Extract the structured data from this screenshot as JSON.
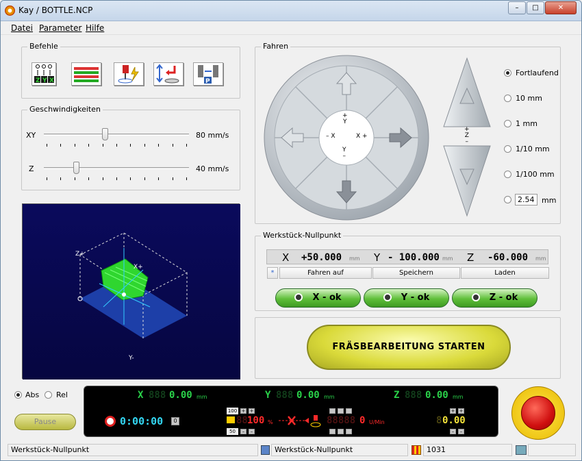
{
  "window": {
    "title": "Kay / BOTTLE.NCP",
    "minimize": "–",
    "maximize": "□",
    "close": "✕"
  },
  "menu": {
    "items": [
      "Datei",
      "Parameter",
      "Hilfe"
    ]
  },
  "befehle": {
    "label": "Befehle",
    "buttons": [
      "zyx-order-icon",
      "table-grid-icon",
      "spindle-lightning-icon",
      "tool-change-icon",
      "probe-p-icon"
    ]
  },
  "geschwindigkeiten": {
    "label": "Geschwindigkeiten",
    "xy": {
      "label": "XY",
      "value": "80 mm/s",
      "fraction": 0.42
    },
    "z": {
      "label": "Z",
      "value": "40 mm/s",
      "fraction": 0.22
    }
  },
  "preview": {
    "zplus": "Z+",
    "xplus": "X+",
    "yminus": "Y-"
  },
  "fahren": {
    "label": "Fahren",
    "center": {
      "yplus": "+\nY",
      "xminus": "– X",
      "xplus": "X +",
      "yminus": "Y\n–"
    },
    "zlabel": "+\nZ\n–",
    "steps": [
      {
        "label": "Fortlaufend",
        "checked": true
      },
      {
        "label": "10 mm",
        "checked": false
      },
      {
        "label": "1 mm",
        "checked": false
      },
      {
        "label": "1/10 mm",
        "checked": false
      },
      {
        "label": "1/100 mm",
        "checked": false
      }
    ],
    "custom": {
      "value": "2.54",
      "unit": "mm"
    }
  },
  "nullpunkt": {
    "label": "Werkstück-Nullpunkt",
    "x": {
      "axis": "X",
      "value": "+50.000",
      "unit": "mm"
    },
    "y": {
      "axis": "Y",
      "value": "- 100.000",
      "unit": "mm"
    },
    "z": {
      "axis": "Z",
      "value": "-60.000",
      "unit": "mm"
    },
    "star": "*",
    "buttons": {
      "fahren": "Fahren auf",
      "speichern": "Speichern",
      "laden": "Laden"
    },
    "ok": {
      "x": "X - ok",
      "y": "Y - ok",
      "z": "Z - ok"
    }
  },
  "start": {
    "label": "FRÄSBEARBEITUNG  STARTEN"
  },
  "mode": {
    "abs": "Abs",
    "rel": "Rel",
    "abs_checked": true
  },
  "pause": {
    "label": "Pause"
  },
  "readout": {
    "x": {
      "axis": "X",
      "value": "0.00",
      "unit": "mm"
    },
    "y": {
      "axis": "Y",
      "value": "0.00",
      "unit": "mm"
    },
    "z": {
      "axis": "Z",
      "value": "0.00",
      "unit": "mm"
    },
    "time": "0:00:00",
    "feed_top": "100",
    "feed_bottom": "50",
    "feed_pct": "100",
    "pct_sign": "%",
    "rpm": "0",
    "rpm_unit": "U/Min",
    "tool": "0.00",
    "zero_btn": "0"
  },
  "status": {
    "left": "Werkstück-Nullpunkt",
    "middle": "Werkstück-Nullpunkt",
    "count": "1031"
  },
  "colors": {
    "green": "#2ad24a",
    "cyan": "#33d6f2",
    "red": "#ff2a2a",
    "yellow": "#f2e23a",
    "preview_bg": "#0a0a6a"
  }
}
